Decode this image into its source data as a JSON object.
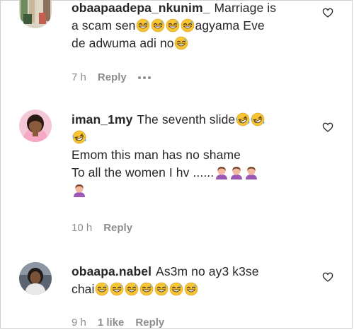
{
  "comments": [
    {
      "username": "obaapaadepa_nkunim_",
      "line1": "Marriage is",
      "line2_prefix": "a scam sen",
      "line2_suffix": "agyama Eve",
      "line3": "de adwuma adi no",
      "time": "7 h",
      "likes": "",
      "reply_label": "Reply",
      "has_more": true
    },
    {
      "username": "iman_1my",
      "line1": "The seventh slide",
      "line3": "Emom this man has no shame",
      "line4": "To all the women I hv ......",
      "time": "10 h",
      "reply_label": "Reply"
    },
    {
      "username": "obaapa.nabel",
      "line1": "As3m no ay3 k3se",
      "line2": "chai",
      "time": "9 h",
      "likes": "1 like",
      "reply_label": "Reply"
    }
  ],
  "colors": {
    "text": "#262626",
    "meta": "#8e8e8e",
    "emoji_face": "#f7c531",
    "woman_emoji": "#9b59b6"
  },
  "icons": [
    "heart-icon",
    "grinning-sweat-emoji",
    "rofl-emoji",
    "woman-facepalming-emoji",
    "more-dots-icon"
  ]
}
